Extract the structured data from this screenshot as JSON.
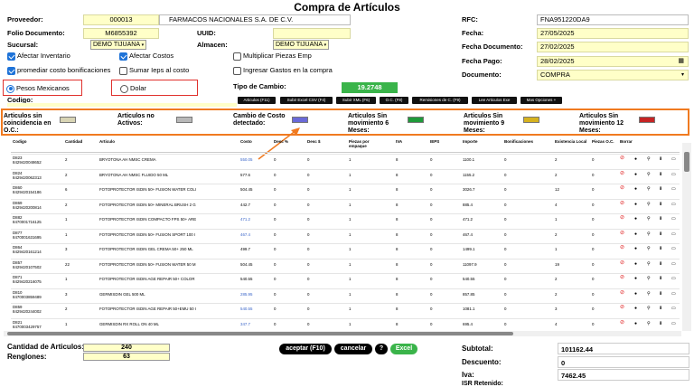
{
  "title": "Compra de Artículos",
  "form": {
    "proveedor_label": "Proveedor:",
    "proveedor_code": "000013",
    "proveedor_name": "FARMACOS NACIONALES S.A. DE C.V.",
    "folio_label": "Folio Documento:",
    "folio": "M6855392",
    "uuid_label": "UUID:",
    "uuid": "",
    "sucursal_label": "Sucursal:",
    "sucursal": "DEMO TIJUANA",
    "almacen_label": "Almacen:",
    "almacen": "DEMO TIJUANA",
    "rfc_label": "RFC:",
    "rfc": "FNA951220DA9",
    "fecha_label": "Fecha:",
    "fecha": "27/05/2025",
    "fecha_doc_label": "Fecha Documento:",
    "fecha_doc": "27/02/2025",
    "fecha_pago_label": "Fecha Pago:",
    "fecha_pago": "28/02/2025",
    "documento_label": "Documento:",
    "documento": "COMPRA",
    "tipo_cambio_label": "Tipo de Cambio:",
    "tipo_cambio": "19.2748",
    "codigo_label": "Codigo:"
  },
  "checks": {
    "afectar_inventario": "Afectar Inventario",
    "afectar_costos": "Afectar Costos",
    "multiplicar": "Multiplicar Piezas Emp",
    "promediar": "promediar costo bonificaciones",
    "sumar_ieps": "Sumar Ieps al costo",
    "ingresar_gastos": "Ingresar Gastos en la compra"
  },
  "radios": {
    "pesos": "Pesos Mexicanos",
    "dolar": "Dolar"
  },
  "action_buttons": [
    "Articulos (F11)",
    "Subir Excel CSV (F4)",
    "Subir XML (F6)",
    "O.C. (F8)",
    "Remisiones de C. (F9)",
    "Lee Articulos Exe",
    "Mas Opciones +"
  ],
  "legend": [
    {
      "label": "Articulos sin coincidencia en O.C.:",
      "color": "#d8d4b4"
    },
    {
      "label": "Articulos no Activos:",
      "color": "#b8b8b8"
    },
    {
      "label": "Cambio de Costo detectado:",
      "color": "#6a6ad8"
    },
    {
      "label": "Articulos Sin movimiento 6 Meses:",
      "color": "#1f9a3a"
    },
    {
      "label": "Articulos Sin movimiento 9 Meses:",
      "color": "#d6b21f"
    },
    {
      "label": "Articulos Sin movimiento 12 Meses:",
      "color": "#c62424"
    }
  ],
  "table": {
    "headers": [
      "Codigo",
      "Cantidad",
      "Articulo",
      "Costo",
      "Desc %",
      "Desc $",
      "Piezas por empaque",
      "IVA",
      "IEPS",
      "Importe",
      "Bonificaciones",
      "Existencia Local",
      "Piezas O.C.",
      "Borrar"
    ],
    "rows": [
      {
        "code": "D823",
        "ean": "8429420048652",
        "qty": "2",
        "name": "BRYOTONA AH NMSC CREMA",
        "cost": "550.05",
        "cc": true,
        "d1": "0",
        "d2": "0",
        "pz": "1",
        "iva": "8",
        "ieps": "0",
        "imp": "1100.1",
        "bon": "0",
        "ex": "2",
        "oc": "0"
      },
      {
        "code": "D824",
        "ean": "8429420062313",
        "qty": "2",
        "name": "BRYOTONA AH NMSC FLUIDO 50 ML",
        "cost": "577.6",
        "cc": false,
        "d1": "0",
        "d2": "0",
        "pz": "1",
        "iva": "8",
        "ieps": "0",
        "imp": "1155.2",
        "bon": "0",
        "ex": "2",
        "oc": "0"
      },
      {
        "code": "D860",
        "ean": "8429420154186",
        "qty": "6",
        "name": "FOTOPROTECTOR ISDIN 50+ FUSION WATER COLI",
        "cost": "504.45",
        "cc": false,
        "d1": "0",
        "d2": "0",
        "pz": "1",
        "iva": "8",
        "ieps": "0",
        "imp": "3026.7",
        "bon": "0",
        "ex": "12",
        "oc": "0"
      },
      {
        "code": "D869",
        "ean": "8429420200814",
        "qty": "2",
        "name": "FOTOPROTECTOR ISDIN 50+ MINERAL BRUSH 2 G",
        "cost": "442.7",
        "cc": false,
        "d1": "0",
        "d2": "0",
        "pz": "1",
        "iva": "8",
        "ieps": "0",
        "imp": "885.4",
        "bon": "0",
        "ex": "4",
        "oc": "0"
      },
      {
        "code": "D882",
        "ean": "8470001716125",
        "qty": "1",
        "name": "FOTOPROTECTOR ISDIN COMPACTO FPS 50+ ARE",
        "cost": "471.2",
        "cc": true,
        "d1": "0",
        "d2": "0",
        "pz": "1",
        "iva": "8",
        "ieps": "0",
        "imp": "471.2",
        "bon": "0",
        "ex": "1",
        "oc": "0"
      },
      {
        "code": "D877",
        "ean": "8470001631695",
        "qty": "1",
        "name": "FOTOPROTECTOR ISDIN 50+ FUSION SPORT 100 I",
        "cost": "467.4",
        "cc": true,
        "d1": "0",
        "d2": "0",
        "pz": "1",
        "iva": "8",
        "ieps": "0",
        "imp": "467.4",
        "bon": "0",
        "ex": "2",
        "oc": "0"
      },
      {
        "code": "D864",
        "ean": "8429420161214",
        "qty": "3",
        "name": "FOTOPROTECTOR ISDIN GEL CREMA 50+ 250 ML",
        "cost": "499.7",
        "cc": false,
        "d1": "0",
        "d2": "0",
        "pz": "1",
        "iva": "8",
        "ieps": "0",
        "imp": "1499.1",
        "bon": "0",
        "ex": "1",
        "oc": "0"
      },
      {
        "code": "D857",
        "ean": "8429420107502",
        "qty": "22",
        "name": "FOTOPROTECTOR ISDIN 50+ FUSION WATER 50 M",
        "cost": "504.45",
        "cc": false,
        "d1": "0",
        "d2": "0",
        "pz": "1",
        "iva": "8",
        "ieps": "0",
        "imp": "11097.9",
        "bon": "0",
        "ex": "19",
        "oc": "0"
      },
      {
        "code": "D871",
        "ean": "8429420216075",
        "qty": "1",
        "name": "FOTOPROTECTOR ISDIN AGE REPAIR 50+ COLOR",
        "cost": "540.55",
        "cc": false,
        "d1": "0",
        "d2": "0",
        "pz": "1",
        "iva": "8",
        "ieps": "0",
        "imp": "540.55",
        "bon": "0",
        "ex": "2",
        "oc": "0"
      },
      {
        "code": "D810",
        "ean": "8470003859489",
        "qty": "3",
        "name": "GERMISDIN GEL 500 ML",
        "cost": "285.95",
        "cc": true,
        "d1": "0",
        "d2": "0",
        "pz": "1",
        "iva": "8",
        "ieps": "0",
        "imp": "857.85",
        "bon": "0",
        "ex": "2",
        "oc": "0"
      },
      {
        "code": "D859",
        "ean": "8429420244002",
        "qty": "2",
        "name": "FOTOPROTECTOR ISDIN AGE REPAIR 50+EMU 50 I",
        "cost": "540.55",
        "cc": true,
        "d1": "0",
        "d2": "0",
        "pz": "1",
        "iva": "8",
        "ieps": "0",
        "imp": "1081.1",
        "bon": "0",
        "ex": "3",
        "oc": "0"
      },
      {
        "code": "D821",
        "ean": "8470003429757",
        "qty": "1",
        "name": "GERMISDIN RX ROLL ON 40 ML",
        "cost": "347.7",
        "cc": true,
        "d1": "0",
        "d2": "0",
        "pz": "1",
        "iva": "8",
        "ieps": "0",
        "imp": "695.4",
        "bon": "0",
        "ex": "4",
        "oc": "0"
      }
    ]
  },
  "bottom": {
    "cantidad_label": "Cantidad de Articulos:",
    "cantidad": "240",
    "renglones_label": "Renglones:",
    "renglones": "63",
    "aceptar": "aceptar (F10)",
    "cancelar": "cancelar",
    "help": "?",
    "excel": "Excel",
    "subtotal_label": "Subtotal:",
    "subtotal": "101162.44",
    "descuento_label": "Descuento:",
    "descuento": "0",
    "iva_label": "Iva:",
    "iva": "7462.45",
    "isr_label": "ISR Retenido:"
  }
}
